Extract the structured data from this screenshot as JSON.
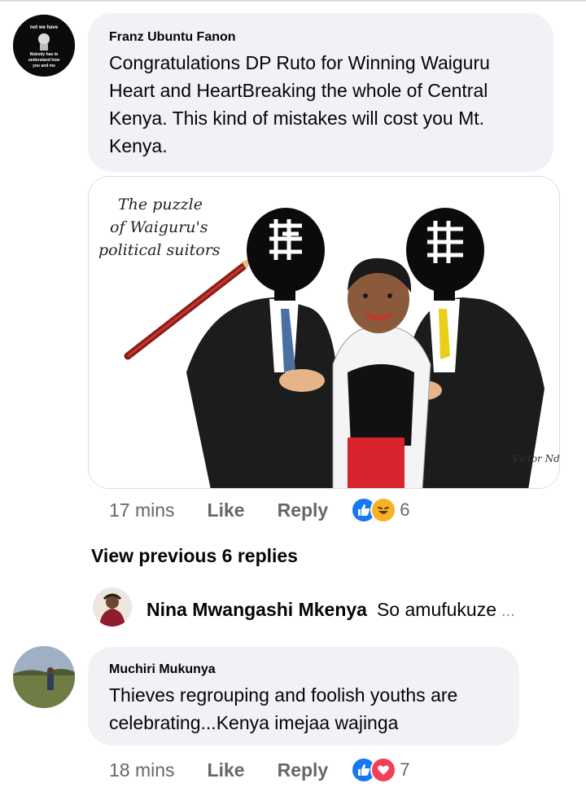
{
  "comments": [
    {
      "author": "Franz Ubuntu Fanon",
      "text": "Congratulations DP Ruto for Winning Waiguru Heart and HeartBreaking the whole of Central Kenya. This kind of mistakes will cost you Mt. Kenya.",
      "time": "17 mins",
      "like_label": "Like",
      "reply_label": "Reply",
      "reactions": [
        "like-icon",
        "haha-icon"
      ],
      "reaction_count": "6",
      "image": {
        "caption_lines": [
          "The puzzle",
          "of Waiguru's",
          "political suitors"
        ],
        "signature": "Victor Ndula"
      }
    },
    {
      "author": "Muchiri Mukunya",
      "text": "Thieves regrouping and foolish youths are celebrating...Kenya imejaa wajinga",
      "time": "18 mins",
      "like_label": "Like",
      "reply_label": "Reply",
      "reactions": [
        "like-icon",
        "love-icon"
      ],
      "reaction_count": "7"
    }
  ],
  "view_previous": "View previous 6 replies",
  "reply_preview": {
    "author": "Nina Mwangashi Mkenya",
    "text": "So amufukuze",
    "ellipsis": "..."
  },
  "avatar_franz_text": [
    "not we have",
    "Nobody has to",
    "understand how",
    "you and me"
  ],
  "colors": {
    "bubble": "#f0f2f5",
    "secondary_text": "#65676b",
    "like_blue": "#1877f2",
    "haha_yellow": "#f7b125",
    "love_red": "#f33e58"
  }
}
